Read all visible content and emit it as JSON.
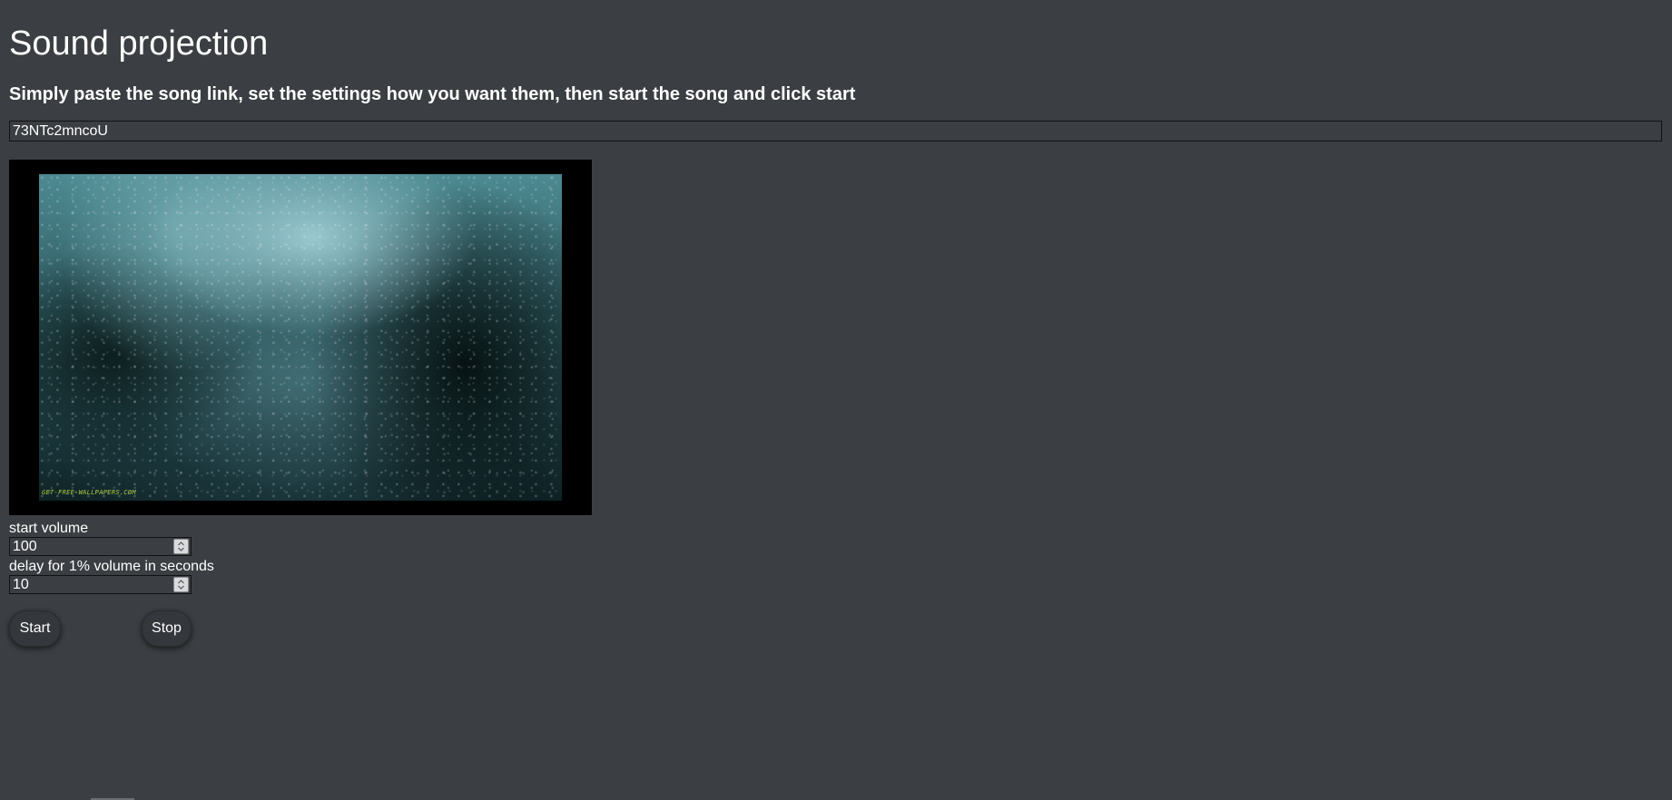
{
  "page": {
    "title": "Sound projection",
    "instructions": "Simply paste the song link, set the settings how you want them, then start the song and click start"
  },
  "song_link": {
    "value": "73NTc2mncoU"
  },
  "video": {
    "watermark": "GET-FREE-WALLPAPERS.COM"
  },
  "settings": {
    "start_volume_label": "start volume",
    "start_volume_value": "100",
    "delay_label": "delay for 1% volume in seconds",
    "delay_value": "10"
  },
  "controls": {
    "start_label": "Start",
    "stop_label": "Stop"
  },
  "colors": {
    "background": "#3b3e42",
    "text": "#ffffff",
    "button": "#34373b"
  }
}
